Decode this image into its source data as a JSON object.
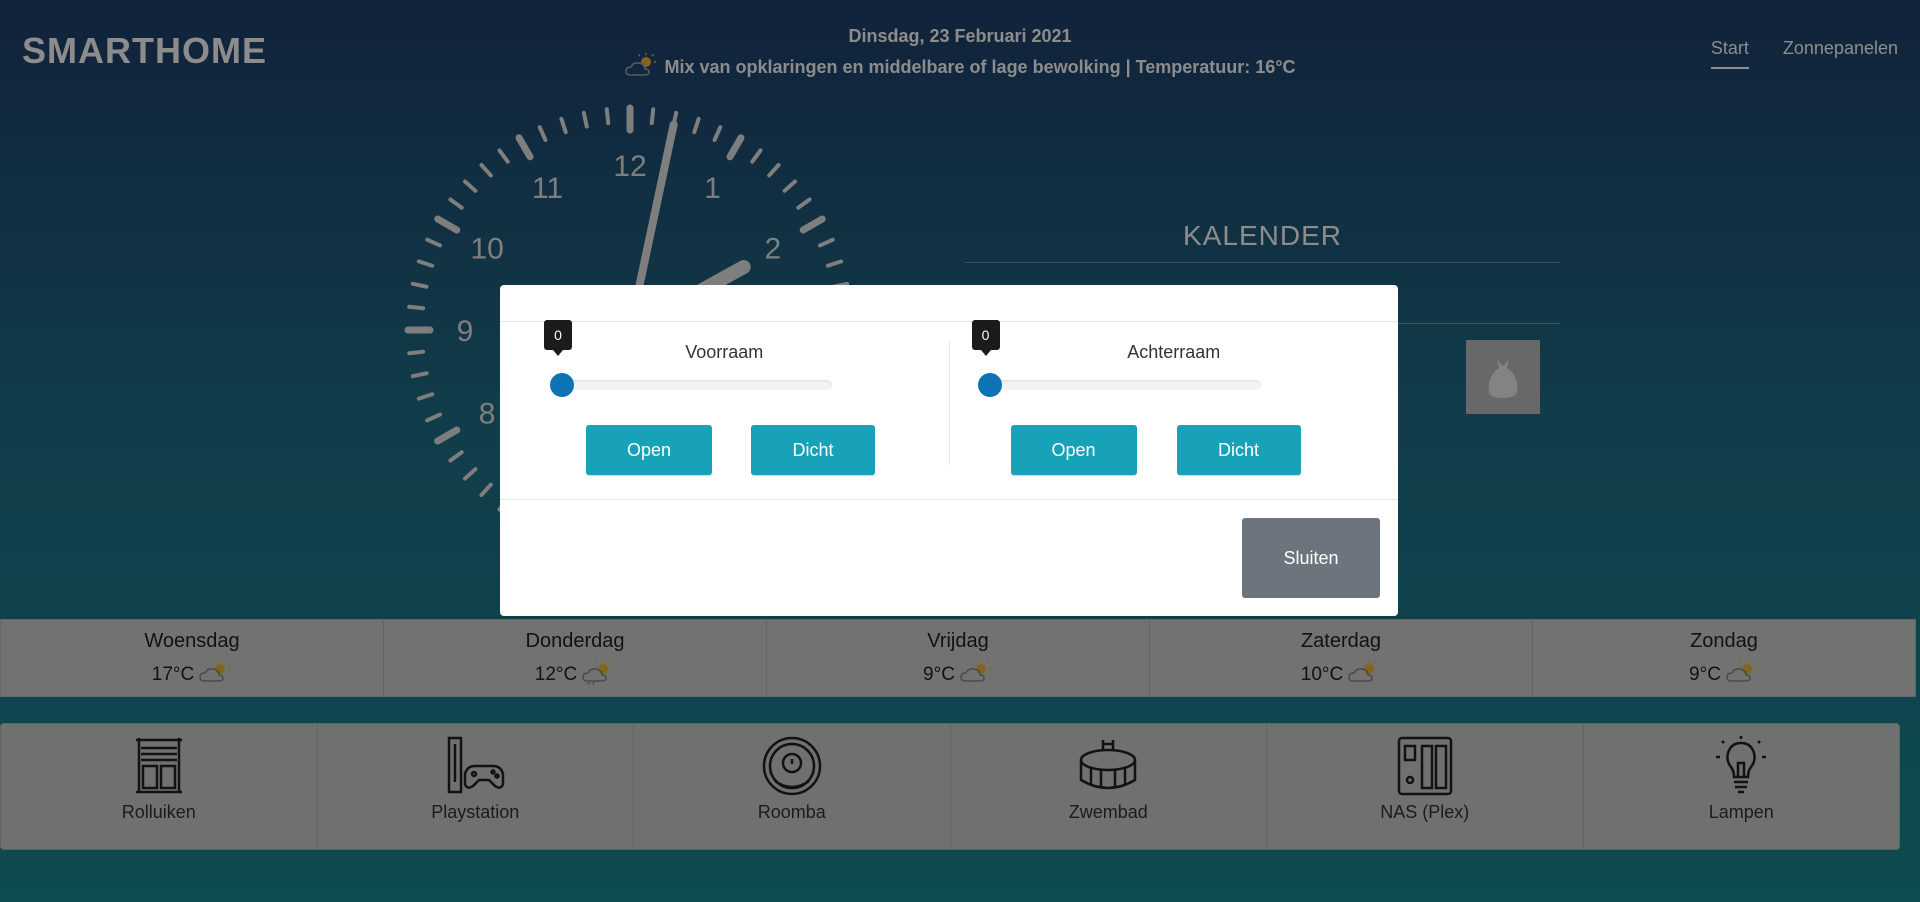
{
  "header": {
    "brand": "SMARTHOME",
    "date": "Dinsdag, 23 Februari 2021",
    "weather_summary": "Mix van opklaringen en middelbare of lage bewolking | Temperatuur: 16°C",
    "weather_icon": "partly-cloudy-icon"
  },
  "nav": {
    "items": [
      {
        "label": "Start",
        "active": true
      },
      {
        "label": "Zonnepanelen",
        "active": false
      }
    ]
  },
  "clock": {
    "numbers": [
      "12",
      "1",
      "2",
      "8",
      "9",
      "10",
      "11"
    ],
    "hour_hand": 14,
    "minute_hand": 2
  },
  "calendar": {
    "title": "KALENDER",
    "icon": "trash-bag-icon"
  },
  "forecast": [
    {
      "day": "Woensdag",
      "temp": "17°C",
      "icon": "partly-cloudy-icon"
    },
    {
      "day": "Donderdag",
      "temp": "12°C",
      "icon": "partly-cloudy-rain-icon"
    },
    {
      "day": "Vrijdag",
      "temp": "9°C",
      "icon": "partly-cloudy-icon"
    },
    {
      "day": "Zaterdag",
      "temp": "10°C",
      "icon": "partly-cloudy-icon"
    },
    {
      "day": "Zondag",
      "temp": "9°C",
      "icon": "partly-cloudy-icon"
    }
  ],
  "devices": [
    {
      "label": "Rolluiken",
      "icon": "shutter-icon"
    },
    {
      "label": "Playstation",
      "icon": "console-icon"
    },
    {
      "label": "Roomba",
      "icon": "robot-vacuum-icon"
    },
    {
      "label": "Zwembad",
      "icon": "pool-icon"
    },
    {
      "label": "NAS (Plex)",
      "icon": "nas-icon"
    },
    {
      "label": "Lampen",
      "icon": "lightbulb-icon"
    }
  ],
  "modal": {
    "left": {
      "label": "Voorraam",
      "value": "0",
      "open": "Open",
      "close": "Dicht"
    },
    "right": {
      "label": "Achterraam",
      "value": "0",
      "open": "Open",
      "close": "Dicht"
    },
    "close_button": "Sluiten"
  },
  "colors": {
    "button_primary": "#17a2b8",
    "button_secondary": "#6c757d",
    "slider_knob": "#0d73b4"
  }
}
